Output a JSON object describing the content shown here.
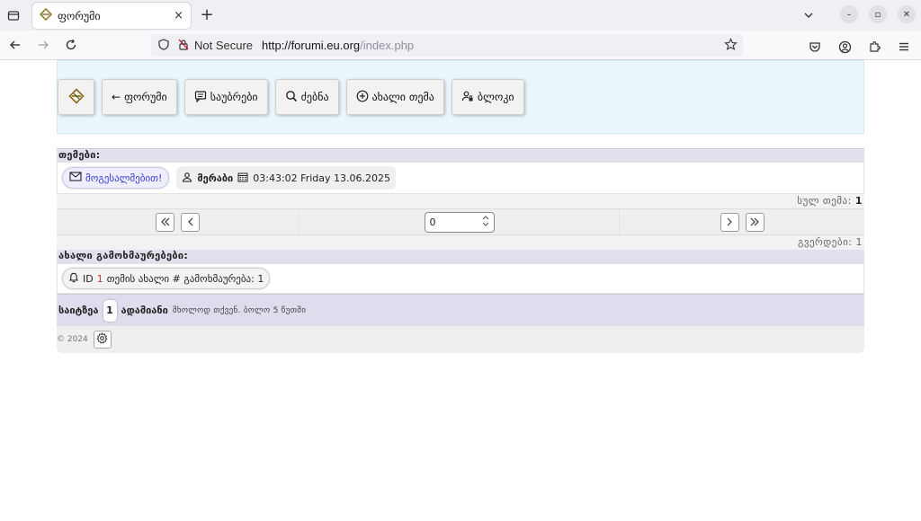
{
  "browser": {
    "tab_title": "ფორუმი",
    "tab_close": "×",
    "new_tab": "+",
    "not_secure": "Not Secure",
    "url_host": "http://forumi.eu.org",
    "url_path": "/index.php"
  },
  "header": {
    "buttons": [
      {
        "label": "ფორუმი",
        "prefix": "←"
      },
      {
        "label": "საუბრები"
      },
      {
        "label": "ძებნა"
      },
      {
        "label": "ახალი თემა"
      },
      {
        "label": "ბლოკი"
      }
    ]
  },
  "topics": {
    "heading": "თემები:",
    "welcome_link": "მოგესალმებით!",
    "guest": "მერაბი",
    "timestamp": "03:43:02 Friday 13.06.2025",
    "total_label": "სულ თემა:",
    "total_value": "1"
  },
  "pager": {
    "page_value": "0",
    "pages_label": "გვერდები:",
    "pages_value": "1"
  },
  "new_replies": {
    "heading": "ახალი გამოხმაურებები:",
    "id_label": "ID",
    "id_value": "1",
    "text": "თემის ახალი # გამოხმაურება: 1"
  },
  "online": {
    "label": "საიტზეა",
    "count": "1",
    "suffix": "ადამიანი",
    "note": "მხოლოდ თქვენ. ბოლო 5 წუთში"
  },
  "footer": {
    "copyright": "© 2024"
  }
}
